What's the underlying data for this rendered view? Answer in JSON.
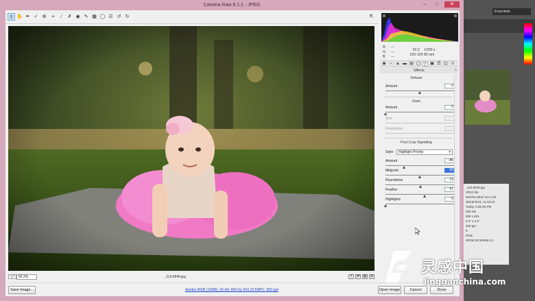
{
  "window": {
    "title": "Camera Raw 9.1.1  -  JPEG"
  },
  "background_app": {
    "workspace_label": "Essentials",
    "file_list": [
      "_DJL9846.jpg",
      "JPEG file",
      "NIKON D810 Ver.1.00",
      "05/15/2015, 11:45:10",
      "Today, 3:35:06 PM",
      "253 KB",
      "900 x 601",
      "5.0\" x 3.3\"",
      "300 ppi",
      "8",
      "RGB",
      "sRGB IEC61966-2.1"
    ]
  },
  "toolbar": {
    "tools": [
      "zoom-icon",
      "hand-icon",
      "white-balance-icon",
      "color-sampler-icon",
      "targeted-adjustment-icon",
      "crop-icon",
      "straighten-icon",
      "spot-removal-icon",
      "red-eye-icon",
      "adjustment-brush-icon",
      "graduated-filter-icon",
      "radial-filter-icon",
      "preferences-icon",
      "rotate-left-icon",
      "rotate-right-icon"
    ]
  },
  "readout": {
    "r_label": "R:",
    "g_label": "G:",
    "b_label": "B:",
    "r_val": "---",
    "g_val": "---",
    "b_val": "---",
    "exposure": "f/2.2",
    "shutter": "1/200 s",
    "iso": "ISO 100",
    "focal": "85 mm"
  },
  "panel": {
    "section_title": "Effects",
    "dehaze": {
      "title": "Dehaze",
      "amount_label": "Amount",
      "amount_value": "0",
      "level": 0.5
    },
    "grain": {
      "title": "Grain",
      "amount_label": "Amount",
      "amount_value": "0",
      "size_label": "Size",
      "size_value": "",
      "roughness_label": "Roughness",
      "roughness_value": "",
      "amount_level": 0.0
    },
    "vignette": {
      "title": "Post Crop Vignetting",
      "style_label": "Style:",
      "style_value": "Highlight Priority",
      "amount_label": "Amount",
      "amount_value": "-46",
      "midpoint_label": "Midpoint",
      "midpoint_value": "50",
      "roundness_label": "Roundness",
      "roundness_value": "+3",
      "feather_label": "Feather",
      "feather_value": "57",
      "highlights_label": "Highlights",
      "highlights_value": "0",
      "levels": {
        "amount": 0.27,
        "midpoint": 0.5,
        "roundness": 0.515,
        "feather": 0.57,
        "highlights": 0.0
      }
    }
  },
  "preview": {
    "zoom": "66.2%",
    "filename": "_DJL9846.jpg"
  },
  "footer": {
    "save_label": "Save Image...",
    "workflow_label": "Adobe RGB (1998); 16 bit; 900 by 601 (0.5MP); 300 ppi",
    "open_label": "Open Image",
    "cancel_label": "Cancel",
    "done_label": "Done"
  },
  "watermark": {
    "cn_text": "灵感中国",
    "url_text": "lingganchina.com"
  },
  "colors": {
    "window_frame": "#d5a9bb",
    "close_button": "#c8445a",
    "link": "#1a3fcf",
    "selected_field": "#3a74d8"
  }
}
